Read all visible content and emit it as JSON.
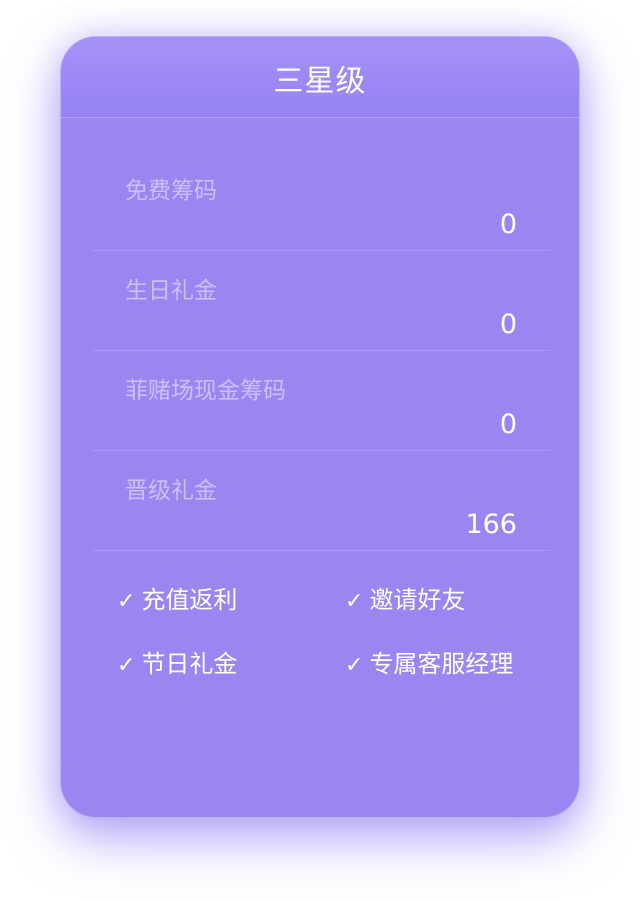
{
  "card": {
    "title": "三星级"
  },
  "rows": [
    {
      "label": "免费筹码",
      "value": "0"
    },
    {
      "label": "生日礼金",
      "value": "0"
    },
    {
      "label": "菲赌场现金筹码",
      "value": "0"
    },
    {
      "label": "晋级礼金",
      "value": "166"
    }
  ],
  "benefits": [
    {
      "icon": "check-icon",
      "check": "✓",
      "label": "充值返利"
    },
    {
      "icon": "check-icon",
      "check": "✓",
      "label": "邀请好友"
    },
    {
      "icon": "check-icon",
      "check": "✓",
      "label": "节日礼金"
    },
    {
      "icon": "check-icon",
      "check": "✓",
      "label": "专属客服经理"
    }
  ],
  "colors": {
    "card_background": "#9b86f1",
    "header_background": "#a692f7",
    "label_text": "#cdbff8",
    "value_text": "#ffffff"
  }
}
